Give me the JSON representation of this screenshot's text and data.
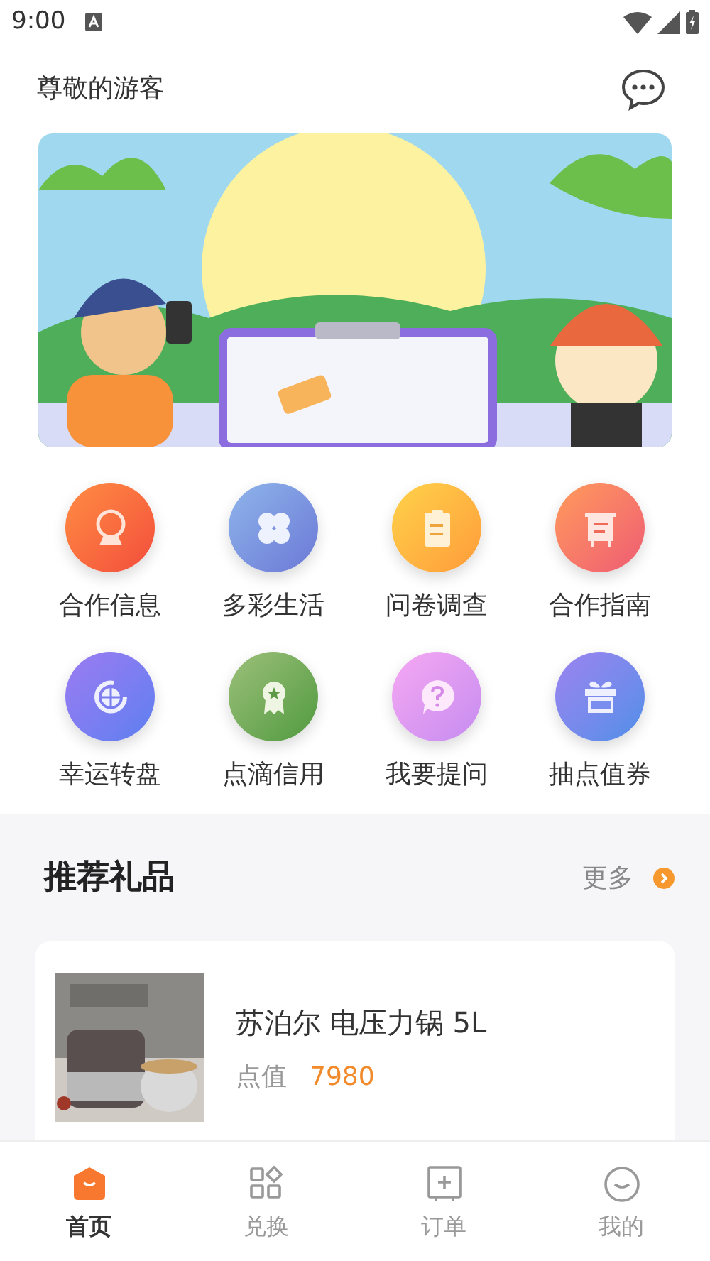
{
  "status_bar": {
    "time": "9:00"
  },
  "header": {
    "greeting": "尊敬的游客"
  },
  "features": [
    {
      "label": "合作信息",
      "kind": "globe"
    },
    {
      "label": "多彩生活",
      "kind": "clover"
    },
    {
      "label": "问卷调查",
      "kind": "clipboard"
    },
    {
      "label": "合作指南",
      "kind": "board"
    },
    {
      "label": "幸运转盘",
      "kind": "wheel"
    },
    {
      "label": "点滴信用",
      "kind": "medal"
    },
    {
      "label": "我要提问",
      "kind": "question"
    },
    {
      "label": "抽点值券",
      "kind": "gift"
    }
  ],
  "recommend": {
    "title": "推荐礼品",
    "more": "更多",
    "items": [
      {
        "name": "苏泊尔 电压力锅 5L",
        "points_label": "点值",
        "points": "7980"
      }
    ]
  },
  "tab_bar": [
    {
      "label": "首页",
      "kind": "home",
      "selected": true
    },
    {
      "label": "兑换",
      "kind": "grid",
      "selected": false
    },
    {
      "label": "订单",
      "kind": "order",
      "selected": false
    },
    {
      "label": "我的",
      "kind": "smile",
      "selected": false
    }
  ]
}
